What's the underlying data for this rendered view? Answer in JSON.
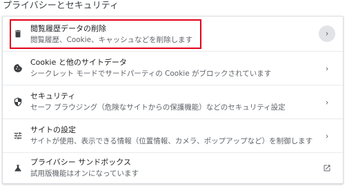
{
  "section": {
    "title": "プライバシーとセキュリティ"
  },
  "rows": [
    {
      "title": "閲覧履歴データの削除",
      "desc": "閲覧履歴、Cookie、キャッシュなどを削除します",
      "icon": "trash-icon",
      "action": "chevron-right-icon"
    },
    {
      "title": "Cookie と他のサイトデータ",
      "desc": "シークレット モードでサードパーティの Cookie がブロックされています",
      "icon": "cookie-icon",
      "action": "chevron-right-icon"
    },
    {
      "title": "セキュリティ",
      "desc": "セーフ ブラウジング（危険なサイトからの保護機能）などのセキュリティ設定",
      "icon": "shield-icon",
      "action": "chevron-right-icon"
    },
    {
      "title": "サイトの設定",
      "desc": "サイトが使用、表示できる情報（位置情報、カメラ、ポップアップなど）を制御します",
      "icon": "sliders-icon",
      "action": "chevron-right-icon"
    },
    {
      "title": "プライバシー サンドボックス",
      "desc": "試用版機能はオンになっています",
      "icon": "flask-icon",
      "action": "external-link-icon"
    }
  ],
  "colors": {
    "highlight": "#e2001a",
    "icon": "#3c4043",
    "chevron": "#5f6368"
  }
}
